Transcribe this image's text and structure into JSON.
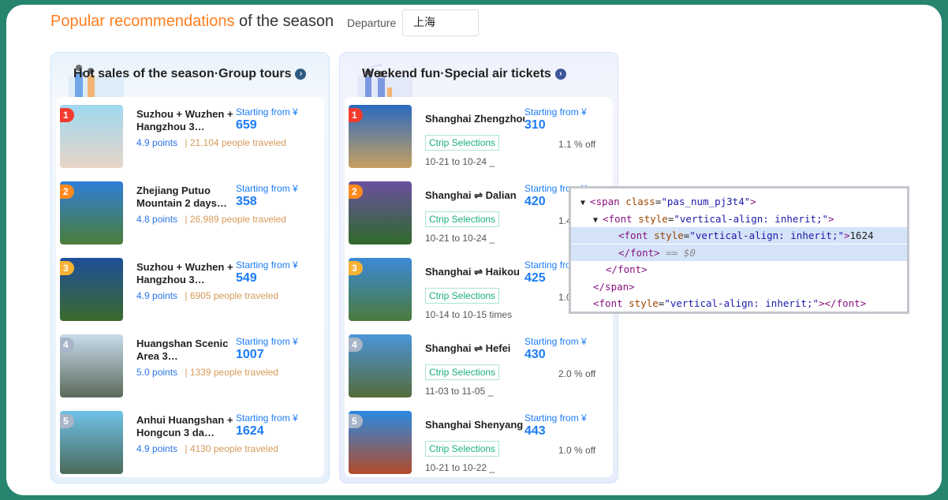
{
  "header": {
    "title_highlight": "Popular recommendations",
    "title_rest": " of the season",
    "departure_label": "Departure",
    "departure_value": "上海"
  },
  "colors": {
    "accent": "#ff7d1e",
    "price": "#1c7cf5",
    "tag": "#19b07a",
    "rank": [
      "#f33b2e",
      "#ff8a1f",
      "#f8b133",
      "#a8b4c8",
      "#a8b4c8"
    ]
  },
  "tours": {
    "title": "Hot sales of the season·Group tours",
    "icon": "chevron-right-circle-icon",
    "items": [
      {
        "rank": "1",
        "name": "Suzhou + Wuzhen + Hangzhou 3…",
        "starting": "Starting from ¥",
        "price": "659",
        "points": "4.9 points",
        "travelers": "| 21,104 people traveled"
      },
      {
        "rank": "2",
        "name": "Zhejiang Putuo Mountain 2 days…",
        "starting": "Starting from ¥",
        "price": "358",
        "points": "4.8 points",
        "travelers": "| 26,989 people traveled"
      },
      {
        "rank": "3",
        "name": "Suzhou + Wuzhen + Hangzhou 3…",
        "starting": "Starting from ¥",
        "price": "549",
        "points": "4.9 points",
        "travelers": "| 6905 people traveled"
      },
      {
        "rank": "4",
        "name": "Huangshan Scenic Area 3…",
        "starting": "Starting from ¥",
        "price": "1007",
        "points": "5.0 points",
        "travelers": "| 1339 people traveled"
      },
      {
        "rank": "5",
        "name": "Anhui Huangshan + Hongcun 3 da…",
        "starting": "Starting from ¥",
        "price": "1624",
        "points": "4.9 points",
        "travelers": "| 4130 people traveled"
      }
    ]
  },
  "flights": {
    "title": "Weekend fun·Special air tickets",
    "icon": "chevron-right-circle-icon",
    "items": [
      {
        "rank": "1",
        "route": "Shanghai  Zhengzhou",
        "starting": "Starting from ¥",
        "price": "310",
        "tag": "Ctrip Selections",
        "discount": "1.1 % off",
        "dates": "10-21 to 10-24 _"
      },
      {
        "rank": "2",
        "route": "Shanghai ⇌ Dalian",
        "starting": "Starting from ¥",
        "price": "420",
        "tag": "Ctrip Selections",
        "discount": "1.4",
        "dates": "10-21 to 10-24 _"
      },
      {
        "rank": "3",
        "route": "Shanghai ⇌ Haikou",
        "starting": "Starting fro",
        "price": "425",
        "tag": "Ctrip Selections",
        "discount": "1.0",
        "dates": "10-14 to 10-15 times"
      },
      {
        "rank": "4",
        "route": "Shanghai ⇌ Hefei",
        "starting": "Starting from ¥",
        "price": "430",
        "tag": "Ctrip Selections",
        "discount": "2.0 % off",
        "dates": "11-03 to 11-05 _"
      },
      {
        "rank": "5",
        "route": "Shanghai  Shenyang",
        "starting": "Starting from ¥",
        "price": "443",
        "tag": "Ctrip Selections",
        "discount": "1.0 % off",
        "dates": "10-21 to 10-22 _"
      }
    ]
  },
  "devtools": {
    "lines": [
      {
        "tag_open": "<span ",
        "attr": "class",
        "value": "\"pas_num_pj3t4\"",
        "close": ">"
      },
      {
        "tag_open": "<font ",
        "attr": "style",
        "value": "\"vertical-align: inherit;\"",
        "close": ">"
      },
      {
        "tag_open": "<font ",
        "attr": "style",
        "value": "\"vertical-align: inherit;\"",
        "close": ">",
        "text": "1624"
      },
      {
        "tag_open": "</font>",
        "note": " == $0"
      },
      {
        "tag_open": "</font>"
      },
      {
        "tag_open": "</span>"
      },
      {
        "tag_open": "<font ",
        "attr": "style",
        "value": "\"vertical-align: inherit;\"",
        "close": "></font>"
      }
    ]
  }
}
